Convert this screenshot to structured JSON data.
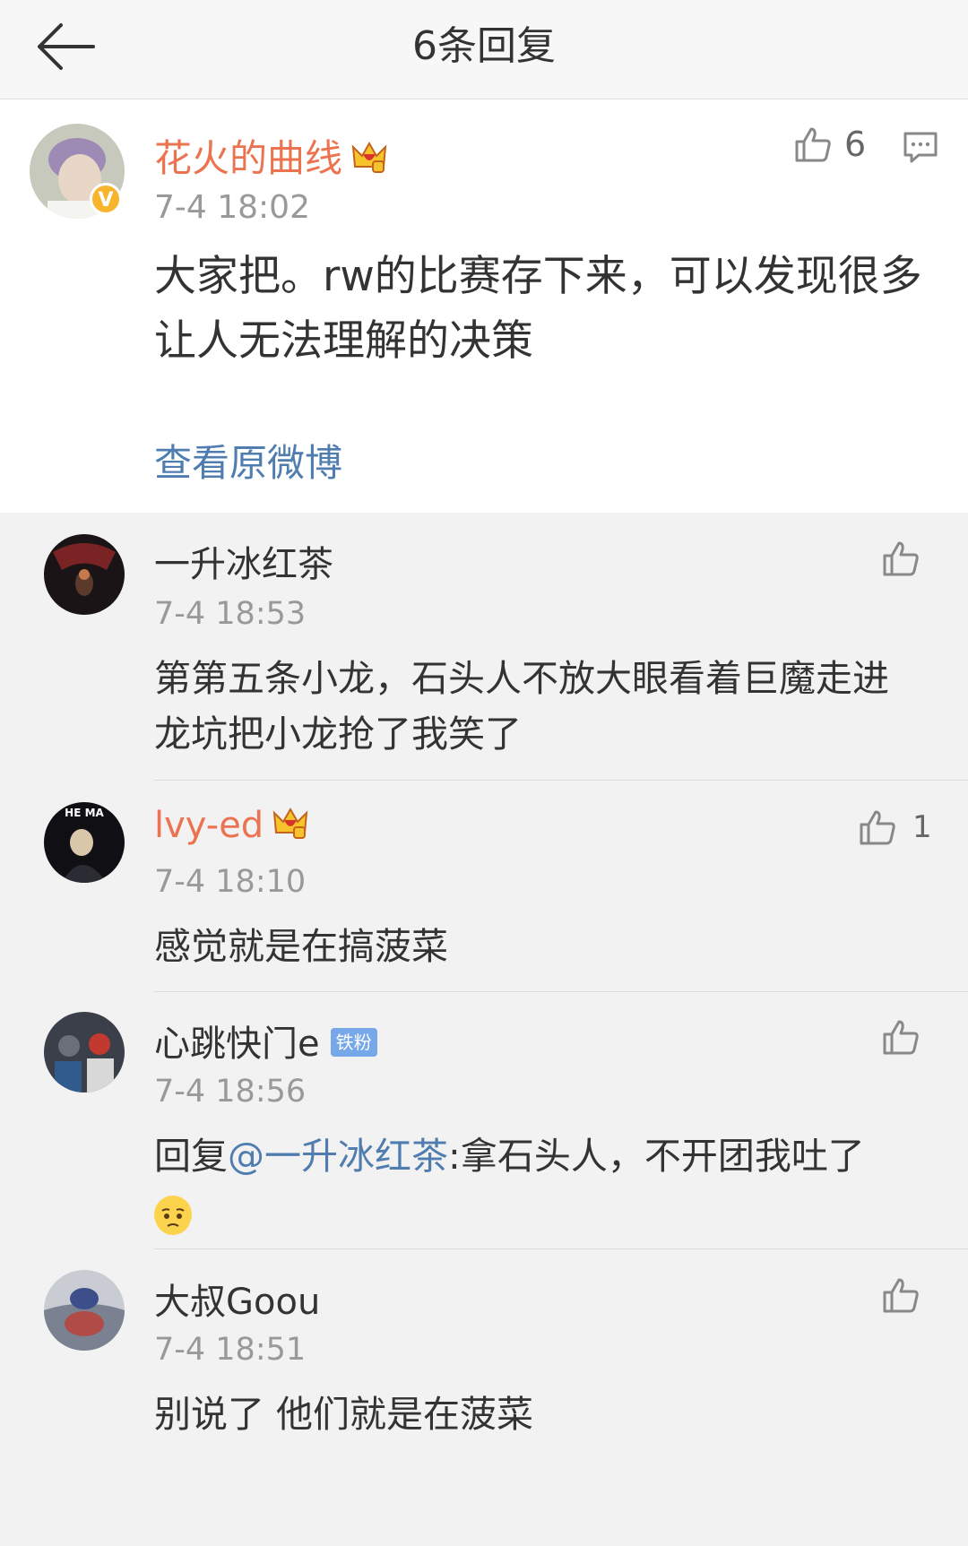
{
  "header": {
    "title": "6条回复"
  },
  "main_post": {
    "username": "花火的曲线",
    "verified_badge": "V",
    "time": "7-4 18:02",
    "like_count": "6",
    "text": "大家把。rw的比赛存下来，可以发现很多让人无法理解的决策",
    "view_original_label": "查看原微博"
  },
  "replies": [
    {
      "username": "一升冰红茶",
      "time": "7-4 18:53",
      "text": "第第五条小龙，石头人不放大眼看着巨魔走进龙坑把小龙抢了我笑了",
      "like_count": ""
    },
    {
      "username": "lvy-ed",
      "time": "7-4 18:10",
      "text": "感觉就是在搞菠菜",
      "like_count": "1",
      "avatar_text": "HE MA"
    },
    {
      "username": "心跳快门e",
      "badge": "铁粉",
      "time": "7-4 18:56",
      "reply_prefix": "回复",
      "mention": "@一升冰红茶",
      "text": ":拿石头人，不开团我吐了",
      "like_count": ""
    },
    {
      "username": "大叔Goou",
      "time": "7-4 18:51",
      "text": "别说了 他们就是在菠菜",
      "like_count": ""
    }
  ],
  "colors": {
    "vip_name": "#eb7350",
    "link": "#507daf",
    "background": "#f2f2f2"
  },
  "icons": [
    "back-arrow-icon",
    "thumbs-up-icon",
    "comment-icon",
    "crown-icon",
    "verified-icon",
    "sad-emoji-icon"
  ]
}
